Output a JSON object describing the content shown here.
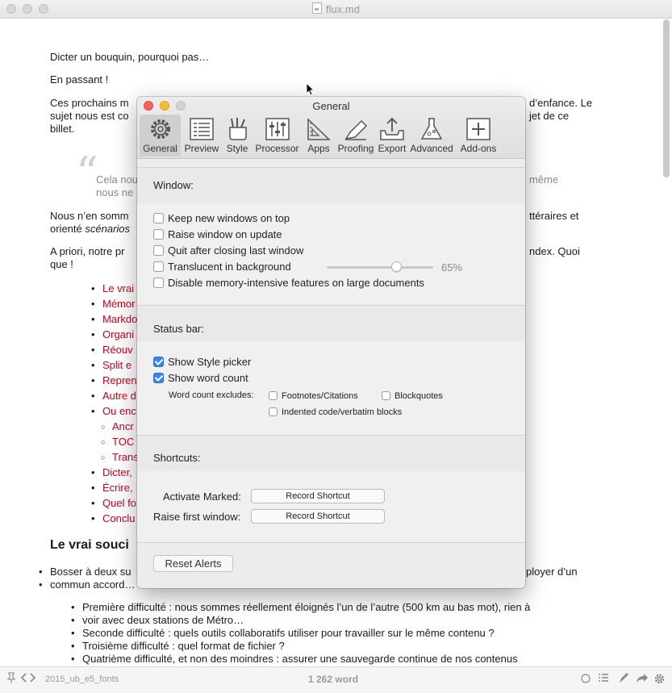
{
  "window": {
    "title": "flux.md"
  },
  "document": {
    "p1": "Dicter un bouquin, pourquoi pas…",
    "p2": "En passant !",
    "p3_a": "Ces prochains m",
    "p3_b": "d’enfance. Le",
    "p3_c": "sujet nous est co",
    "p3_d": "jet de ce",
    "p3_e": "billet.",
    "quote_mark": "“",
    "quote_a": "Cela nou",
    "quote_b": "même",
    "quote_c": "nous ne",
    "p4_a": "Nous n’en somm",
    "p4_b": "ttéraires et",
    "p4_c": "orienté ",
    "p4_c_italic": "scénarios",
    "p5_a": "A priori, notre pr",
    "p5_b": "ndex. Quoi",
    "p5_c": "que !",
    "toc": [
      "Le vrai",
      "Mémor",
      "Markdo",
      "Organi",
      "Réouv",
      "Split e",
      "Repren",
      "Autre d",
      "Ou enc"
    ],
    "toc_sub": [
      "Ancr",
      "TOC",
      "Trans"
    ],
    "toc_after": [
      "Dicter,",
      "Écrire,",
      "Quel fo",
      "Conclu"
    ],
    "heading": "Le vrai souci",
    "p6_a": "Bosser à deux su",
    "p6_b": "ployer d’un",
    "p6_c": "commun accord…",
    "list": [
      "Première difficulté : nous sommes réellement éloignés l’un de l’autre (500 km au bas mot), rien à",
      "voir avec deux stations de Métro…",
      "Seconde difficulté : quels outils collaboratifs utiliser pour travailler sur le même contenu ?",
      "Troisième difficulté : quel format de fichier ?",
      "Quatrième difficulté, et non des moindres : assurer une sauvegarde continue de nos contenus"
    ]
  },
  "status_bar": {
    "style": "2015_ub_e5_fonts",
    "word_count": "1 262 word"
  },
  "prefs": {
    "title": "General",
    "tabs": [
      {
        "label": "General",
        "icon": "gear-icon"
      },
      {
        "label": "Preview",
        "icon": "preview-icon"
      },
      {
        "label": "Style",
        "icon": "style-icon"
      },
      {
        "label": "Processor",
        "icon": "processor-icon"
      },
      {
        "label": "Apps",
        "icon": "apps-icon"
      },
      {
        "label": "Proofing",
        "icon": "proofing-icon"
      },
      {
        "label": "Export",
        "icon": "export-icon"
      },
      {
        "label": "Advanced",
        "icon": "advanced-icon"
      },
      {
        "label": "Add-ons",
        "icon": "add-ons-icon"
      }
    ],
    "window_section": {
      "heading": "Window:",
      "options": [
        {
          "label": "Keep new windows on top",
          "checked": false
        },
        {
          "label": "Raise window on update",
          "checked": false
        },
        {
          "label": "Quit after closing last window",
          "checked": false
        },
        {
          "label": "Translucent in background",
          "checked": false
        },
        {
          "label": "Disable memory-intensive features on large documents",
          "checked": false
        }
      ],
      "translucency_value": "65%",
      "translucency_level": 0.65
    },
    "status_section": {
      "heading": "Status bar:",
      "options": [
        {
          "label": "Show Style picker",
          "checked": true
        },
        {
          "label": "Show word count",
          "checked": true
        }
      ],
      "excludes_label": "Word count excludes:",
      "excludes": [
        {
          "label": "Footnotes/Citations",
          "checked": false
        },
        {
          "label": "Blockquotes",
          "checked": false
        },
        {
          "label": "Indented code/verbatim blocks",
          "checked": false
        }
      ]
    },
    "shortcuts_section": {
      "heading": "Shortcuts:",
      "activate_label": "Activate Marked:",
      "raise_label": "Raise first window:",
      "record_label": "Record Shortcut"
    },
    "reset_label": "Reset Alerts"
  }
}
